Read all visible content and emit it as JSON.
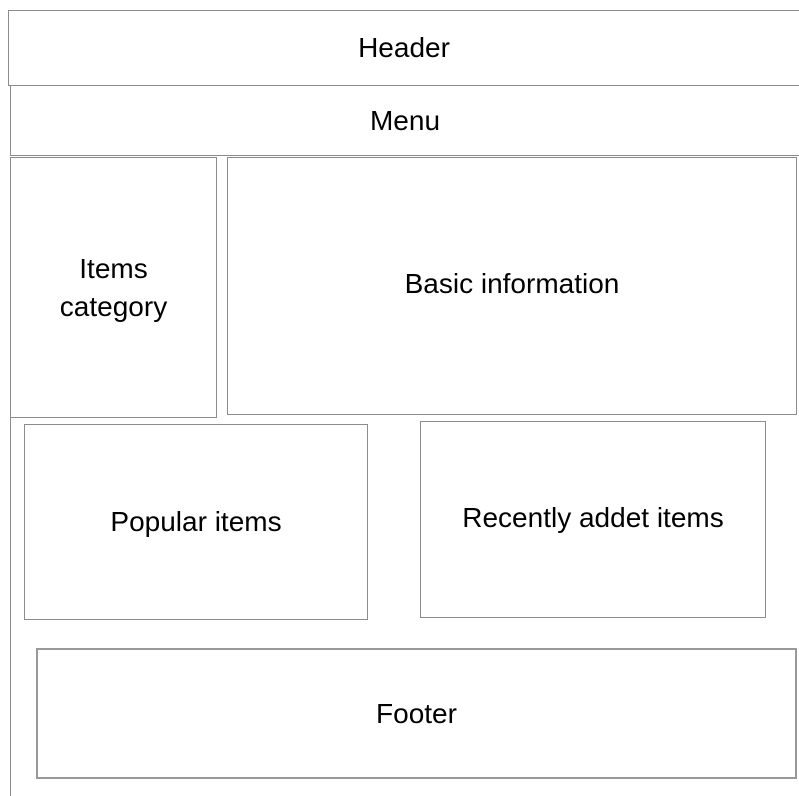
{
  "wireframe": {
    "header": "Header",
    "menu": "Menu",
    "category_line1": "Items",
    "category_line2": "category",
    "basic_info": "Basic information",
    "popular": "Popular items",
    "recent": "Recently addet items",
    "footer": "Footer"
  },
  "colors": {
    "border": "#8c8c8c",
    "background": "#ffffff",
    "text": "#000000"
  }
}
